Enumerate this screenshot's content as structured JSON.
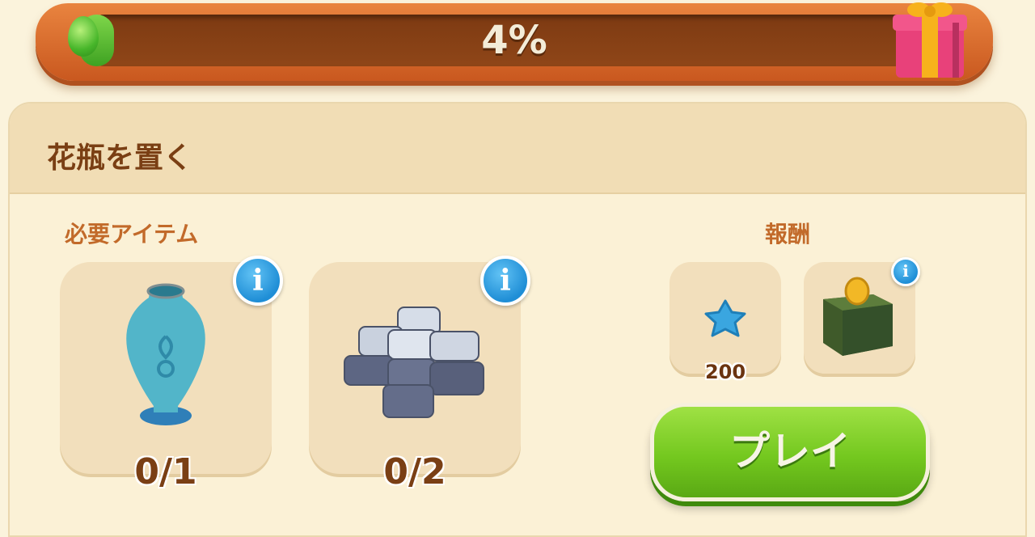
{
  "progress": {
    "value_percent": 4,
    "label": "4%"
  },
  "task": {
    "title": "花瓶を置く"
  },
  "required": {
    "label": "必要アイテム",
    "items": [
      {
        "icon": "vase-icon",
        "count": "0/1"
      },
      {
        "icon": "stone-tiles-icon",
        "count": "0/2"
      }
    ]
  },
  "rewards": {
    "label": "報酬",
    "items": [
      {
        "icon": "blue-star-icon",
        "value": "200"
      },
      {
        "icon": "coin-box-icon"
      }
    ]
  },
  "play_button": {
    "label": "プレイ"
  },
  "colors": {
    "accent_green": "#74c81f",
    "bar_orange": "#e06e2b",
    "title_brown": "#7a3f14"
  }
}
